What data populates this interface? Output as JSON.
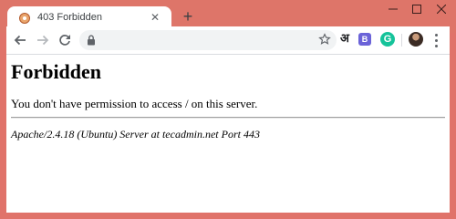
{
  "tab": {
    "title": "403 Forbidden",
    "favicon": "site-favicon",
    "close_symbol": "✕"
  },
  "new_tab_symbol": "+",
  "toolbar": {
    "address_url": "",
    "extensions": {
      "hindi_symbol": "अ",
      "b_symbol": "B",
      "g_symbol": "G"
    }
  },
  "page": {
    "heading": "Forbidden",
    "message": "You don't have permission to access / on this server.",
    "server_signature": "Apache/2.4.18 (Ubuntu) Server at tecadmin.net Port 443"
  },
  "colors": {
    "frame": "#de7569",
    "page_background": "#ffffff"
  }
}
